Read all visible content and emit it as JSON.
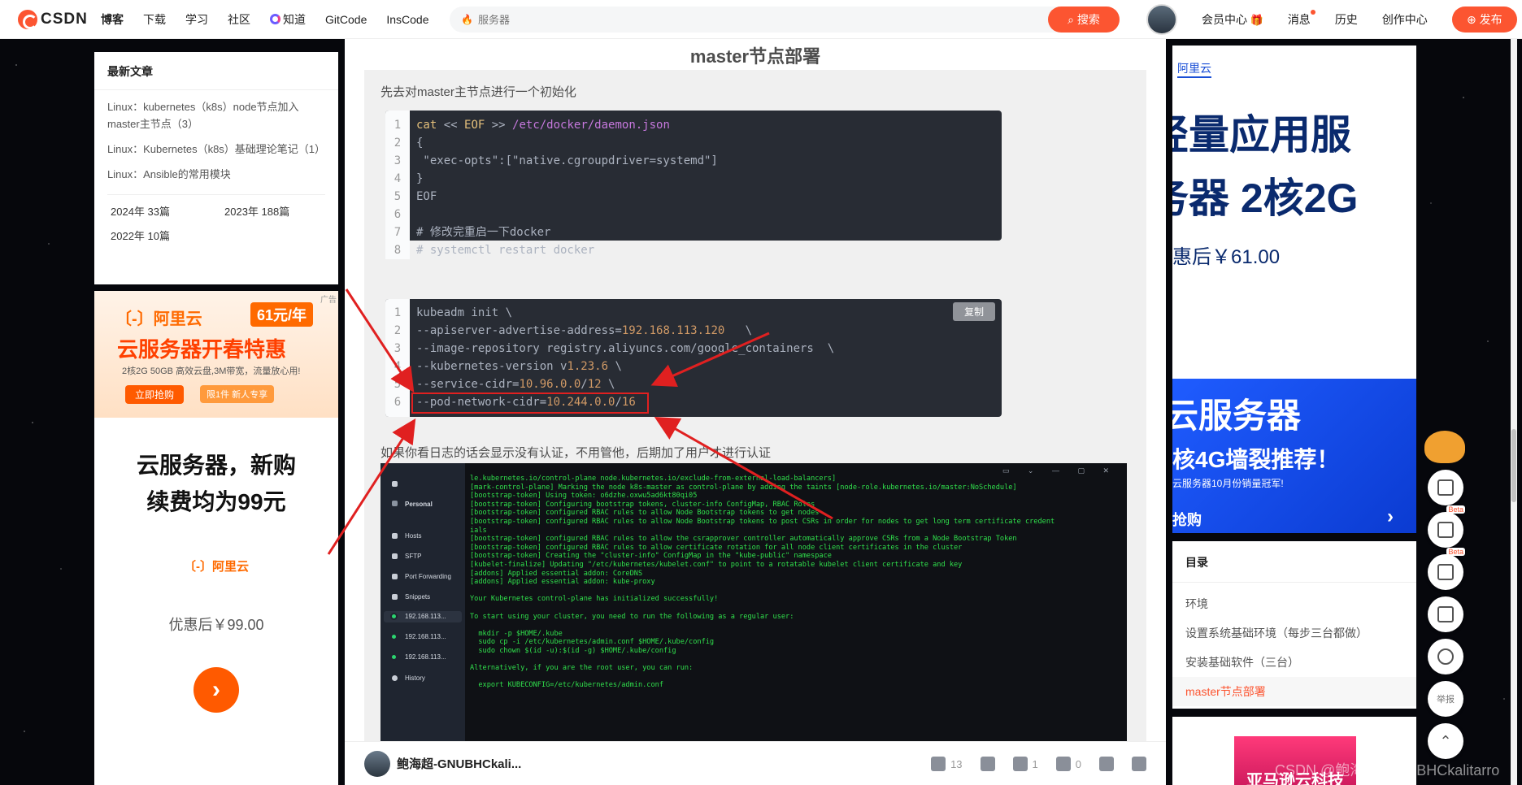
{
  "nav": {
    "logo": "CSDN",
    "items": [
      "博客",
      "下载",
      "学习",
      "社区",
      "知道",
      "GitCode",
      "InsCode"
    ],
    "search_placeholder": "服务器",
    "search_button": "搜索",
    "right": {
      "member": "会员中心",
      "messages": "消息",
      "history": "历史",
      "creator": "创作中心",
      "publish": "发布"
    }
  },
  "sidebar": {
    "recent_title": "最新文章",
    "recent": [
      "Linux：kubernetes（k8s）node节点加入master主节点（3）",
      "Linux：Kubernetes（k8s）基础理论笔记（1）",
      "Linux：Ansible的常用模块"
    ],
    "archive": [
      "2024年 33篇",
      "2023年 188篇",
      "2022年 10篇"
    ]
  },
  "ad_left": {
    "tag": "广告",
    "brand": "〔-〕阿里云",
    "price_badge": "61元/年",
    "headline": "云服务器开春特惠",
    "sub": "2核2G 50GB 高效云盘,3M带宽，流量放心用!",
    "btn1": "立即抢购",
    "btn2": "限1件 新人专享",
    "body_title_1": "云服务器，新购",
    "body_title_2": "续费均为99元",
    "body_brand": "〔-〕阿里云",
    "body_price": "优惠后￥99.00",
    "arrow": "›"
  },
  "article": {
    "section_title": "master节点部署",
    "para1": "先去对master主节点进行一个初始化",
    "code1": [
      "cat << EOF >> /etc/docker/daemon.json",
      "{",
      " \"exec-opts\":[\"native.cgroupdriver=systemd\"]",
      "}",
      "EOF",
      "",
      "# 修改完重启一下docker",
      "# systemctl restart docker"
    ],
    "copy_label": "复制",
    "code2": [
      "kubeadm init \\",
      "--apiserver-advertise-address=192.168.113.120   \\",
      "--image-repository registry.aliyuncs.com/google_containers  \\",
      "--kubernetes-version v1.23.6 \\",
      "--service-cidr=10.96.0.0/12 \\",
      "--pod-network-cidr=10.244.0.0/16"
    ],
    "para2": "如果你看日志的话会显示没有认证，不用管他，后期加了用户才进行认证"
  },
  "terminal": {
    "sidebar": {
      "vault": "Personal",
      "items": [
        "Hosts",
        "SFTP",
        "Port Forwarding",
        "Snippets"
      ],
      "hosts": [
        "192.168.113...",
        "192.168.113...",
        "192.168.113..."
      ],
      "history": "History"
    },
    "lines": [
      "le.kubernetes.io/control-plane node.kubernetes.io/exclude-from-external-load-balancers]",
      "[mark-control-plane] Marking the node k8s-master as control-plane by adding the taints [node-role.kubernetes.io/master:NoSchedule]",
      "[bootstrap-token] Using token: o6dzhe.oxwu5ad6kt80qi05",
      "[bootstrap-token] Configuring bootstrap tokens, cluster-info ConfigMap, RBAC Roles",
      "[bootstrap-token] configured RBAC rules to allow Node Bootstrap tokens to get nodes",
      "[bootstrap-token] configured RBAC rules to allow Node Bootstrap tokens to post CSRs in order for nodes to get long term certificate credent",
      "ials",
      "[bootstrap-token] configured RBAC rules to allow the csrapprover controller automatically approve CSRs from a Node Bootstrap Token",
      "[bootstrap-token] configured RBAC rules to allow certificate rotation for all node client certificates in the cluster",
      "[bootstrap-token] Creating the \"cluster-info\" ConfigMap in the \"kube-public\" namespace",
      "[kubelet-finalize] Updating \"/etc/kubernetes/kubelet.conf\" to point to a rotatable kubelet client certificate and key",
      "[addons] Applied essential addon: CoreDNS",
      "[addons] Applied essential addon: kube-proxy",
      "",
      "Your Kubernetes control-plane has initialized successfully!",
      "",
      "To start using your cluster, you need to run the following as a regular user:",
      "",
      "  mkdir -p $HOME/.kube",
      "  sudo cp -i /etc/kubernetes/admin.conf $HOME/.kube/config",
      "  sudo chown $(id -u):$(id -g) $HOME/.kube/config",
      "",
      "Alternatively, if you are the root user, you can run:",
      "",
      "  export KUBECONFIG=/etc/kubernetes/admin.conf"
    ]
  },
  "author_bar": {
    "name": "鲍海超-GNUBHCkali...",
    "likes": "13",
    "favorites": "1",
    "comments": "0"
  },
  "ad_right": {
    "brand": "阿里云",
    "line1": "轻量应用服",
    "line2": "务器 2核2G",
    "price": "惠后￥61.00",
    "b1": "云服务器",
    "b2": "核4G墙裂推荐！",
    "b3": "云服务器10月份销量冠军!",
    "b4": "抢购",
    "arrow": "›"
  },
  "toc": {
    "title": "目录",
    "items": [
      "环境",
      "设置系统基础环境（每步三台都做）",
      "安装基础软件（三台）",
      "master节点部署"
    ]
  },
  "ad_right_bottom": "亚马逊云科技",
  "float_tools": {
    "beta": "Beta",
    "report": "举报"
  },
  "watermark": "CSDN @鲍海超-GNUBHCkalitarro",
  "colors": {
    "accent": "#fc5531",
    "annotation_red": "#e02020",
    "terminal_green": "#30e04c"
  }
}
